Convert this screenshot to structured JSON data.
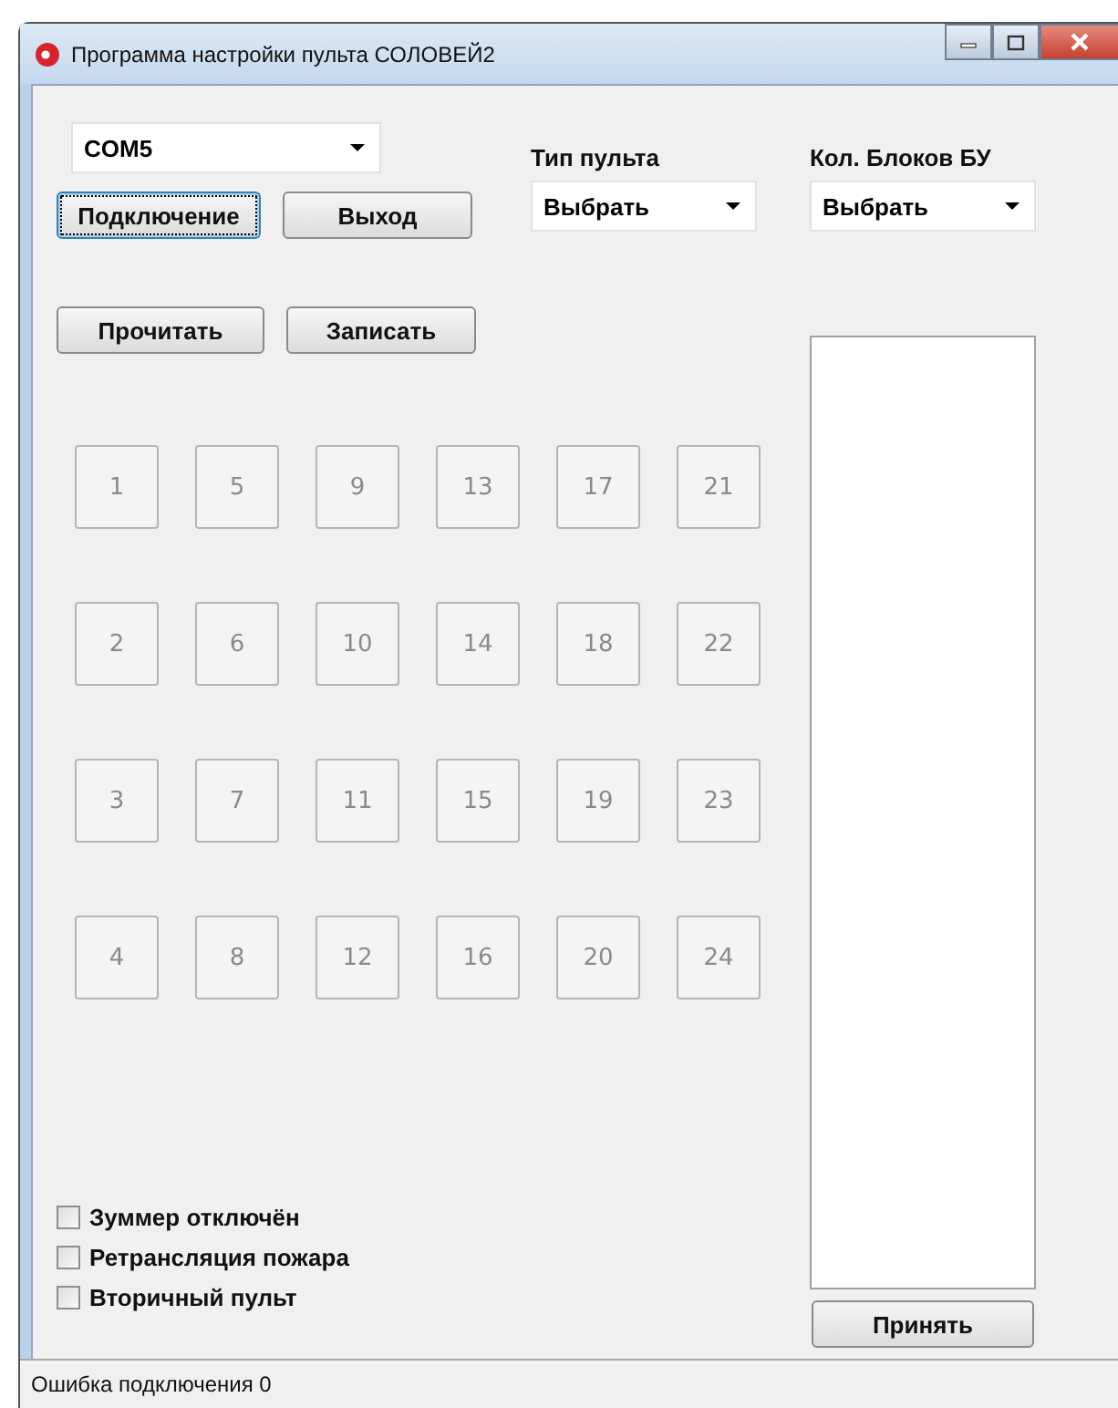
{
  "window": {
    "title": "Программа настройки пульта СОЛОВЕЙ2"
  },
  "port_select": {
    "value": "COM5"
  },
  "connect_buttons": [
    {
      "label": "Подключение",
      "focused": true
    },
    {
      "label": "Выход",
      "focused": false
    }
  ],
  "type_select": {
    "label": "Тип пульта",
    "value": "Выбрать"
  },
  "blocks_select": {
    "label": "Кол. Блоков БУ",
    "value": "Выбрать"
  },
  "io_buttons": [
    "Прочитать",
    "Записать"
  ],
  "channel_rows": [
    [
      {
        "label": "1",
        "disabled": true
      },
      {
        "label": "5",
        "disabled": true
      },
      {
        "label": "9",
        "disabled": true
      },
      {
        "label": "13",
        "disabled": true
      },
      {
        "label": "17",
        "disabled": true
      },
      {
        "label": "21",
        "disabled": true
      }
    ],
    [
      {
        "label": "2",
        "disabled": true
      },
      {
        "label": "6",
        "disabled": true
      },
      {
        "label": "10",
        "disabled": true
      },
      {
        "label": "14",
        "disabled": true
      },
      {
        "label": "18",
        "disabled": true
      },
      {
        "label": "22",
        "disabled": true
      }
    ],
    [
      {
        "label": "3",
        "disabled": true
      },
      {
        "label": "7",
        "disabled": true
      },
      {
        "label": "11",
        "disabled": true
      },
      {
        "label": "15",
        "disabled": true
      },
      {
        "label": "19",
        "disabled": true
      },
      {
        "label": "23",
        "disabled": true
      }
    ],
    [
      {
        "label": "4",
        "disabled": true
      },
      {
        "label": "8",
        "disabled": true
      },
      {
        "label": "12",
        "disabled": true
      },
      {
        "label": "16",
        "disabled": true
      },
      {
        "label": "20",
        "disabled": true
      },
      {
        "label": "24",
        "disabled": true
      }
    ]
  ],
  "options": [
    {
      "label": "Зуммер отключён",
      "checked": false
    },
    {
      "label": "Ретрансляция пожара",
      "checked": false
    },
    {
      "label": "Вторичный пульт",
      "checked": false
    }
  ],
  "accept_button": "Принять",
  "status_bar": "Ошибка подключения 0"
}
